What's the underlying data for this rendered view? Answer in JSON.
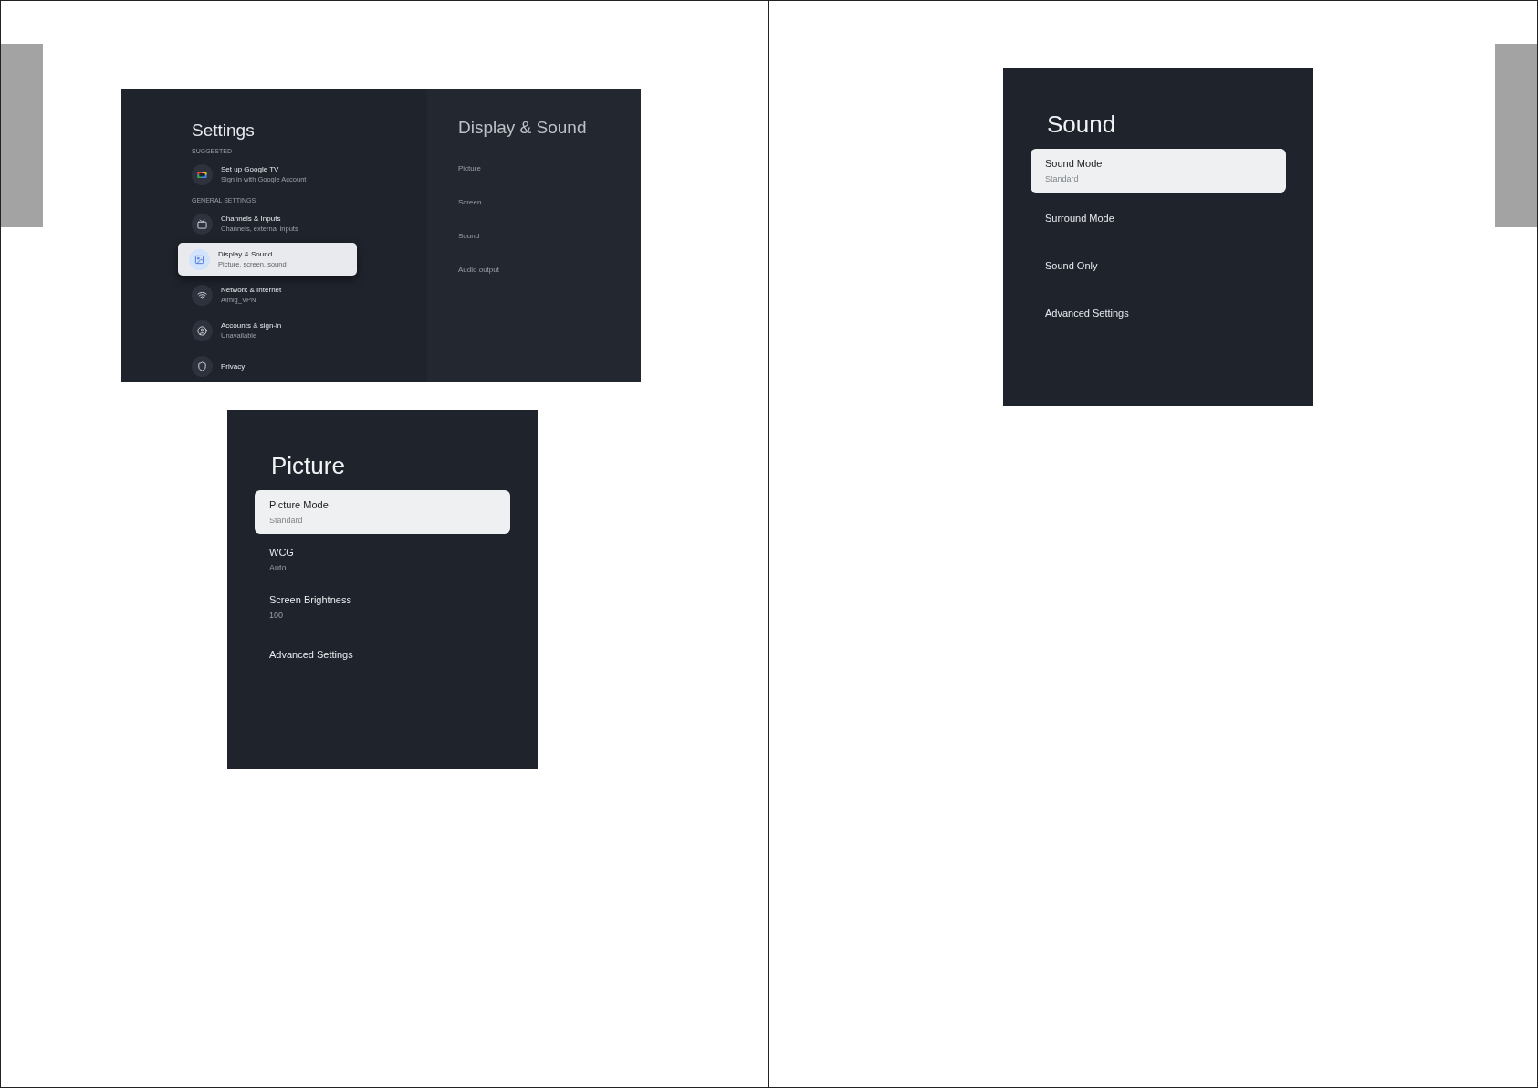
{
  "settings": {
    "title": "Settings",
    "sections": [
      {
        "label": "SUGGESTED",
        "items": [
          {
            "title": "Set up Google TV",
            "subtitle": "Sign in with Google Account",
            "selected": false
          }
        ]
      },
      {
        "label": "GENERAL SETTINGS",
        "items": [
          {
            "title": "Channels & Inputs",
            "subtitle": "Channels, external inputs",
            "selected": false
          },
          {
            "title": "Display & Sound",
            "subtitle": "Picture, screen, sound",
            "selected": true
          },
          {
            "title": "Network & Internet",
            "subtitle": "Aimig_VPN",
            "selected": false
          },
          {
            "title": "Accounts & sign-in",
            "subtitle": "Unavailable",
            "selected": false
          },
          {
            "title": "Privacy",
            "selected": false
          }
        ]
      }
    ],
    "detail": {
      "title": "Display & Sound",
      "items": [
        "Picture",
        "Screen",
        "Sound",
        "Audio output"
      ]
    }
  },
  "picture_menu": {
    "title": "Picture",
    "items": [
      {
        "title": "Picture Mode",
        "subtitle": "Standard",
        "selected": true
      },
      {
        "title": "WCG",
        "subtitle": "Auto",
        "selected": false
      },
      {
        "title": "Screen Brightness",
        "subtitle": "100",
        "selected": false
      },
      {
        "title": "Advanced Settings",
        "selected": false
      }
    ]
  },
  "sound_menu": {
    "title": "Sound",
    "items": [
      {
        "title": "Sound Mode",
        "subtitle": "Standard",
        "selected": true
      },
      {
        "title": "Surround Mode",
        "selected": false
      },
      {
        "title": "Sound Only",
        "selected": false
      },
      {
        "title": "Advanced Settings",
        "selected": false
      }
    ]
  }
}
